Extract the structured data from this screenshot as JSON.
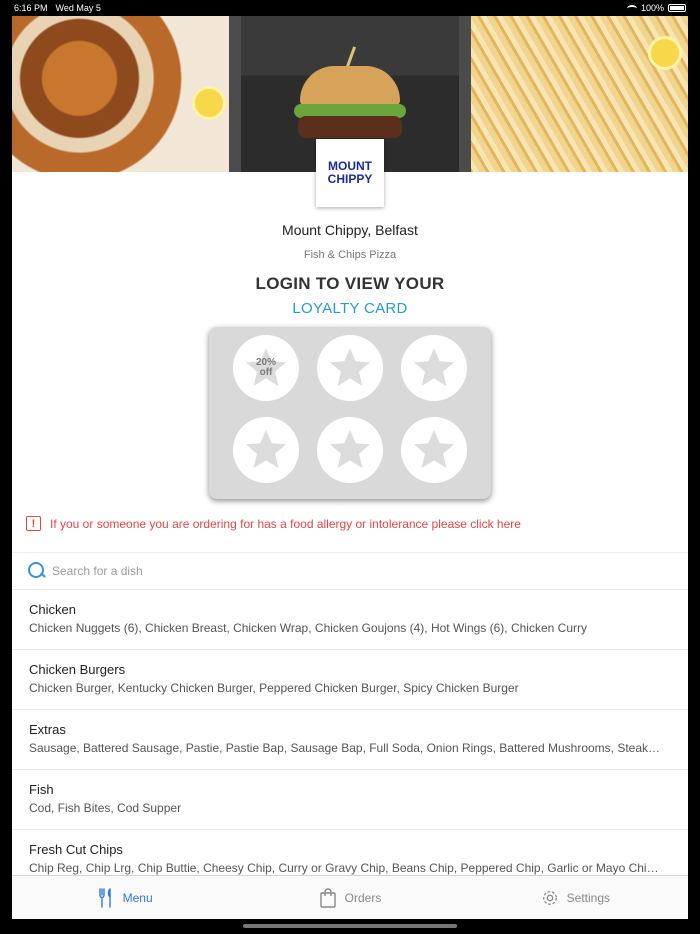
{
  "status_bar": {
    "time": "6:16 PM",
    "date": "Wed May 5",
    "battery": "100%"
  },
  "restaurant": {
    "logo_line1": "MOUNT",
    "logo_line2": "CHIPPY",
    "name": "Mount Chippy, Belfast",
    "type": "Fish & Chips Pizza",
    "brand_color": "#1e2b97"
  },
  "loyalty": {
    "title": "LOGIN TO VIEW YOUR",
    "subtitle": "LOYALTY CARD",
    "reward_line1": "20%",
    "reward_line2": "off",
    "stamps_total": 6,
    "accent_color": "#2a9ac9"
  },
  "allergy": {
    "icon": "!",
    "text": "If you or someone you are ordering for has a food allergy or intolerance please click here",
    "color": "#e04848"
  },
  "search": {
    "placeholder": "Search for a dish",
    "icon": "search-icon"
  },
  "categories": [
    {
      "name": "Chicken",
      "items": "Chicken Nuggets (6), Chicken Breast, Chicken Wrap, Chicken Goujons (4), Hot Wings (6), Chicken Curry"
    },
    {
      "name": "Chicken Burgers",
      "items": "Chicken Burger, Kentucky Chicken Burger, Peppered Chicken Burger, Spicy Chicken Burger"
    },
    {
      "name": "Extras",
      "items": "Sausage, Battered Sausage, Pastie, Pastie Bap, Sausage Bap, Full Soda, Onion Rings, Battered Mushrooms, Steak…"
    },
    {
      "name": "Fish",
      "items": "Cod, Fish Bites, Cod Supper"
    },
    {
      "name": "Fresh Cut Chips",
      "items": "Chip Reg, Chip Lrg, Chip Buttie, Cheesy Chip, Curry or Gravy Chip, Beans Chip, Peppered Chip, Garlic or Mayo Chi…"
    }
  ],
  "tabs": [
    {
      "label": "Menu",
      "icon": "fork-knife-icon",
      "active": true
    },
    {
      "label": "Orders",
      "icon": "bag-icon",
      "active": false
    },
    {
      "label": "Settings",
      "icon": "gear-icon",
      "active": false
    }
  ],
  "active_color": "#2f7ad6"
}
